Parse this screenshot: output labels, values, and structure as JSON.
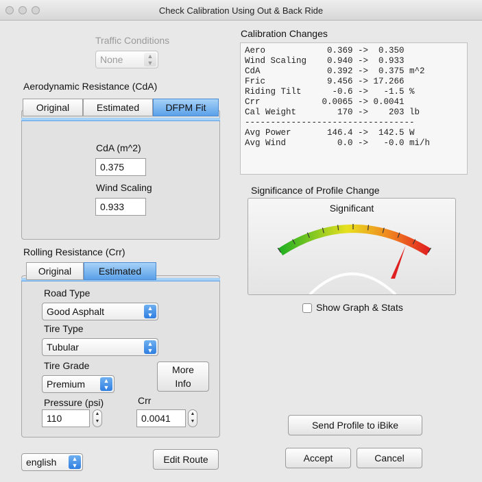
{
  "window": {
    "title": "Check Calibration Using Out & Back Ride"
  },
  "traffic": {
    "label": "Traffic Conditions",
    "value": "None"
  },
  "aero": {
    "heading": "Aerodynamic Resistance (CdA)",
    "tabs": [
      "Original",
      "Estimated",
      "DFPM Fit"
    ],
    "cda_label": "CdA (m^2)",
    "cda_value": "0.375",
    "wind_label": "Wind Scaling",
    "wind_value": "0.933"
  },
  "rolling": {
    "heading": "Rolling Resistance (Crr)",
    "tabs": [
      "Original",
      "Estimated"
    ],
    "road_type_label": "Road Type",
    "road_type_value": "Good Asphalt",
    "tire_type_label": "Tire Type",
    "tire_type_value": "Tubular",
    "tire_grade_label": "Tire Grade",
    "tire_grade_value": "Premium",
    "more_info_line1": "More",
    "more_info_line2": "Info",
    "pressure_label": "Pressure (psi)",
    "pressure_value": "110",
    "crr_label": "Crr",
    "crr_value": "0.0041"
  },
  "language": {
    "value": "english"
  },
  "buttons": {
    "edit_route": "Edit Route",
    "send_profile": "Send Profile to iBike",
    "accept": "Accept",
    "cancel": "Cancel"
  },
  "calibration": {
    "heading": "Calibration Changes",
    "lines": [
      "Aero            0.369 ->  0.350",
      "Wind Scaling    0.940 ->  0.933",
      "CdA             0.392 ->  0.375 m^2",
      "Fric            9.456 -> 17.266",
      "Riding Tilt      -0.6 ->   -1.5 %",
      "Crr            0.0065 -> 0.0041",
      "Cal Weight        170 ->    203 lb",
      "---------------------------------",
      "Avg Power       146.4 ->  142.5 W",
      "Avg Wind          0.0 ->   -0.0 mi/h"
    ]
  },
  "significance": {
    "heading": "Significance of Profile Change",
    "value_text": "Significant",
    "gauge_level": 0.85
  },
  "show_graph": {
    "label": "Show Graph & Stats",
    "checked": false
  },
  "colors": {
    "accent": "#5aa0e8",
    "gauge_low": "#22b022",
    "gauge_mid": "#e8e020",
    "gauge_high": "#e02020",
    "needle": "#e02020"
  }
}
